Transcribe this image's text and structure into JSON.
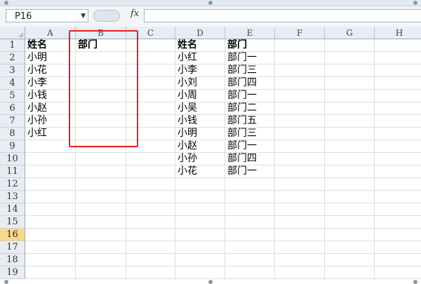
{
  "formula_bar": {
    "name_box": "P16",
    "fx_label": "fx",
    "formula_value": ""
  },
  "columns": [
    "A",
    "B",
    "C",
    "D",
    "E",
    "F",
    "G",
    "H"
  ],
  "rows": [
    "1",
    "2",
    "3",
    "4",
    "5",
    "6",
    "7",
    "8",
    "9",
    "10",
    "11",
    "12",
    "13",
    "14",
    "15",
    "16",
    "17",
    "18",
    "19"
  ],
  "active_row": "16",
  "cells": [
    {
      "col": "A",
      "row": 1,
      "value": "姓名",
      "bold": true
    },
    {
      "col": "B",
      "row": 1,
      "value": "部门",
      "bold": true
    },
    {
      "col": "A",
      "row": 2,
      "value": "小明"
    },
    {
      "col": "A",
      "row": 3,
      "value": "小花"
    },
    {
      "col": "A",
      "row": 4,
      "value": "小李"
    },
    {
      "col": "A",
      "row": 5,
      "value": "小钱"
    },
    {
      "col": "A",
      "row": 6,
      "value": "小赵"
    },
    {
      "col": "A",
      "row": 7,
      "value": "小孙"
    },
    {
      "col": "A",
      "row": 8,
      "value": "小红"
    },
    {
      "col": "D",
      "row": 1,
      "value": "姓名",
      "bold": true
    },
    {
      "col": "E",
      "row": 1,
      "value": "部门",
      "bold": true
    },
    {
      "col": "D",
      "row": 2,
      "value": "小红"
    },
    {
      "col": "E",
      "row": 2,
      "value": "部门一"
    },
    {
      "col": "D",
      "row": 3,
      "value": "小李"
    },
    {
      "col": "E",
      "row": 3,
      "value": "部门三"
    },
    {
      "col": "D",
      "row": 4,
      "value": "小刘"
    },
    {
      "col": "E",
      "row": 4,
      "value": "部门四"
    },
    {
      "col": "D",
      "row": 5,
      "value": "小周"
    },
    {
      "col": "E",
      "row": 5,
      "value": "部门一"
    },
    {
      "col": "D",
      "row": 6,
      "value": "小吴"
    },
    {
      "col": "E",
      "row": 6,
      "value": "部门二"
    },
    {
      "col": "D",
      "row": 7,
      "value": "小钱"
    },
    {
      "col": "E",
      "row": 7,
      "value": "部门五"
    },
    {
      "col": "D",
      "row": 8,
      "value": "小明"
    },
    {
      "col": "E",
      "row": 8,
      "value": "部门三"
    },
    {
      "col": "D",
      "row": 9,
      "value": "小赵"
    },
    {
      "col": "E",
      "row": 9,
      "value": "部门一"
    },
    {
      "col": "D",
      "row": 10,
      "value": "小孙"
    },
    {
      "col": "E",
      "row": 10,
      "value": "部门四"
    },
    {
      "col": "D",
      "row": 11,
      "value": "小花"
    },
    {
      "col": "E",
      "row": 11,
      "value": "部门一"
    }
  ],
  "highlight": {
    "color": "#e3221c",
    "range": "B1:B9"
  }
}
